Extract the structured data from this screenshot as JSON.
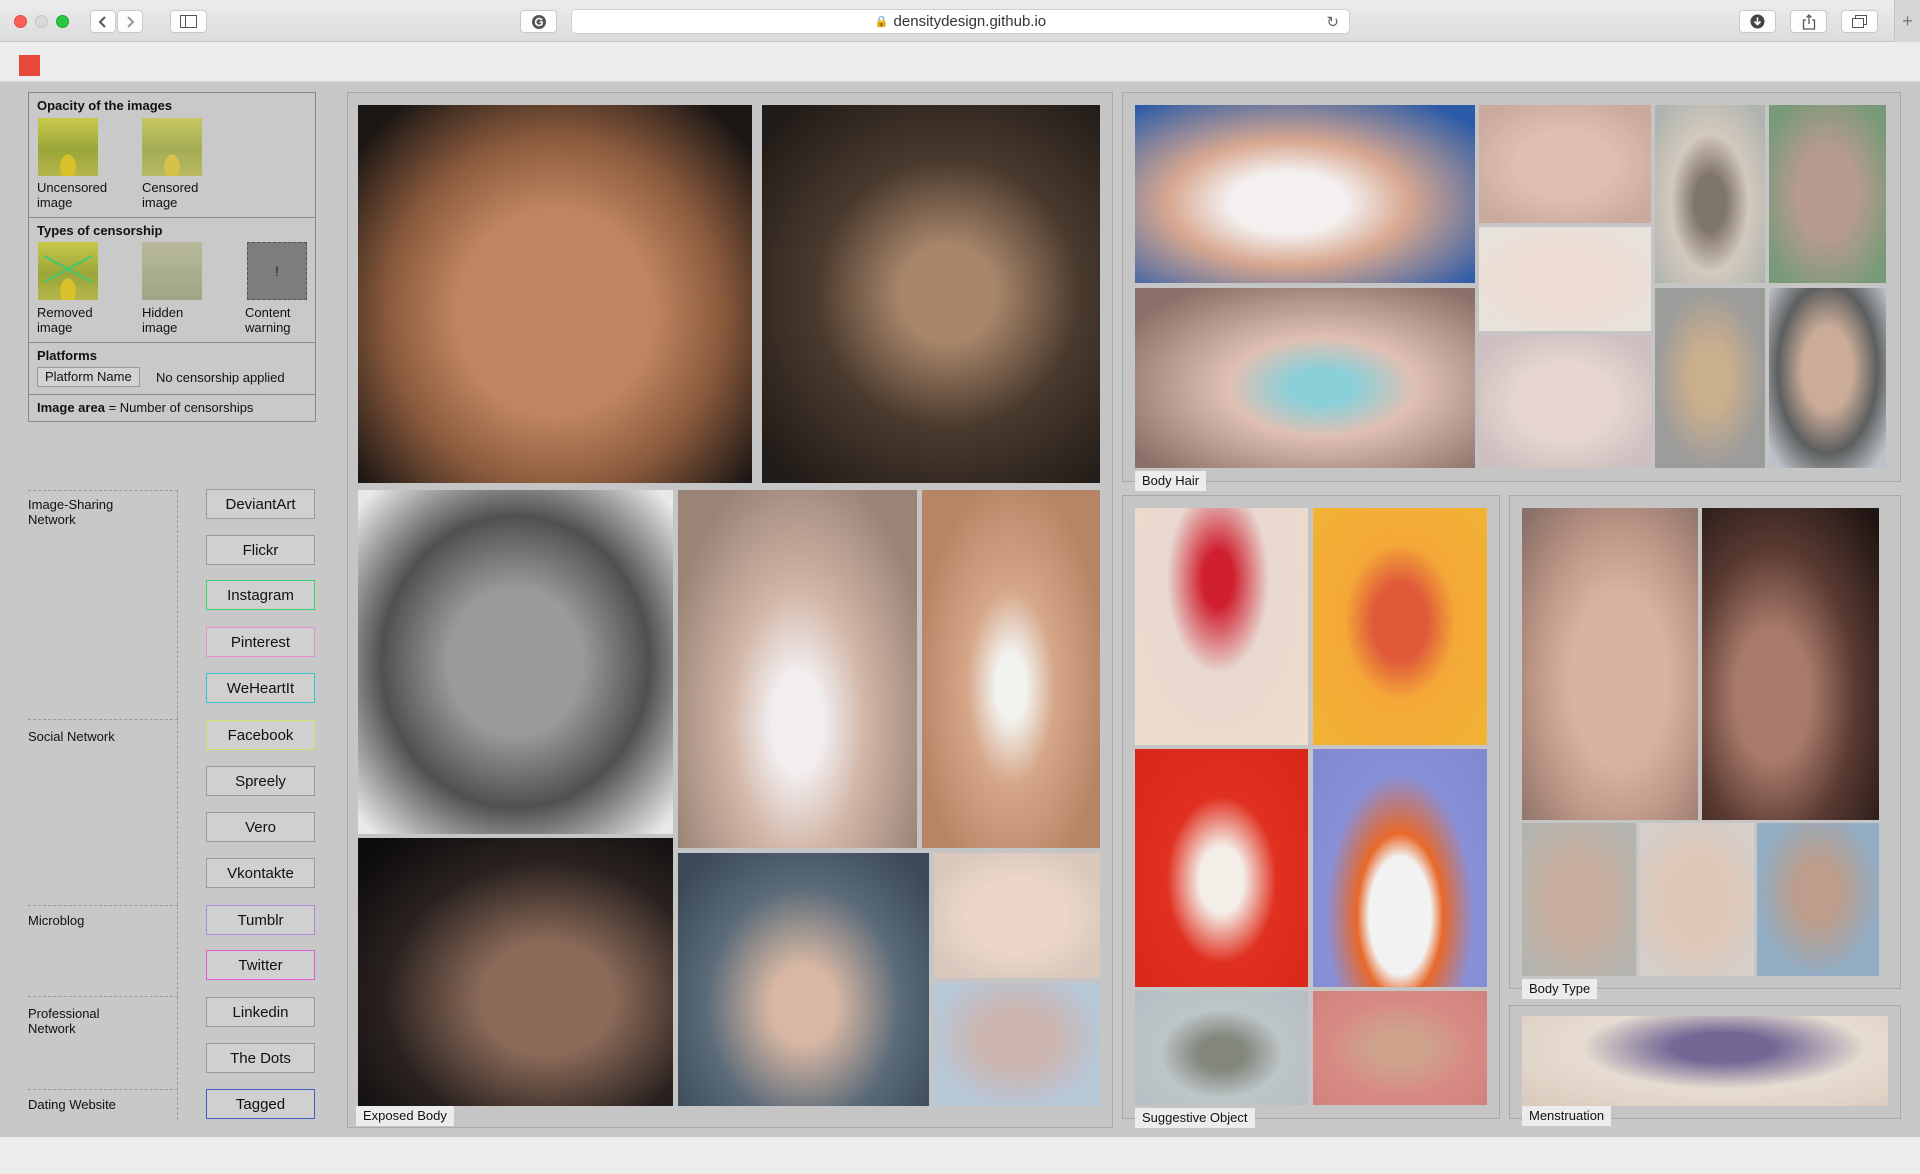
{
  "browser": {
    "url": "densitydesign.github.io"
  },
  "legend": {
    "opacity_title": "Opacity of the images",
    "uncensored_label": "Uncensored image",
    "censored_label": "Censored image",
    "types_title": "Types of censorship",
    "removed_label": "Removed image",
    "hidden_label": "Hidden image",
    "warning_label": "Content warning",
    "warning_glyph": "!",
    "platforms_title": "Platforms",
    "platform_chip": "Platform Name",
    "no_censorship": "No censorship applied",
    "area_bold": "Image area",
    "area_text": "= Number of censorships"
  },
  "categories": [
    {
      "label": "Image-Sharing Network"
    },
    {
      "label": "Social Network"
    },
    {
      "label": "Microblog"
    },
    {
      "label": "Professional Network"
    },
    {
      "label": "Dating Website"
    }
  ],
  "platforms": [
    {
      "label": "DeviantArt",
      "border": "#9a9a9a"
    },
    {
      "label": "Flickr",
      "border": "#9a9a9a"
    },
    {
      "label": "Instagram",
      "border": "#3bd468"
    },
    {
      "label": "Pinterest",
      "border": "#e98fd0"
    },
    {
      "label": "WeHeartIt",
      "border": "#39c0c9"
    },
    {
      "label": "Facebook",
      "border": "#d9dd6a"
    },
    {
      "label": "Spreely",
      "border": "#9a9a9a"
    },
    {
      "label": "Vero",
      "border": "#9a9a9a"
    },
    {
      "label": "Vkontakte",
      "border": "#9a9a9a"
    },
    {
      "label": "Tumblr",
      "border": "#a98bd9"
    },
    {
      "label": "Twitter",
      "border": "#de5fd5"
    },
    {
      "label": "Linkedin",
      "border": "#9a9a9a"
    },
    {
      "label": "The Dots",
      "border": "#9a9a9a"
    },
    {
      "label": "Tagged",
      "border": "#3f5fb8"
    }
  ],
  "panels": {
    "exposed_body": "Exposed Body",
    "body_hair": "Body Hair",
    "suggestive_object": "Suggestive Object",
    "body_type": "Body Type",
    "menstruation": "Menstruation"
  },
  "colors": {
    "brand": "#e8473c"
  }
}
